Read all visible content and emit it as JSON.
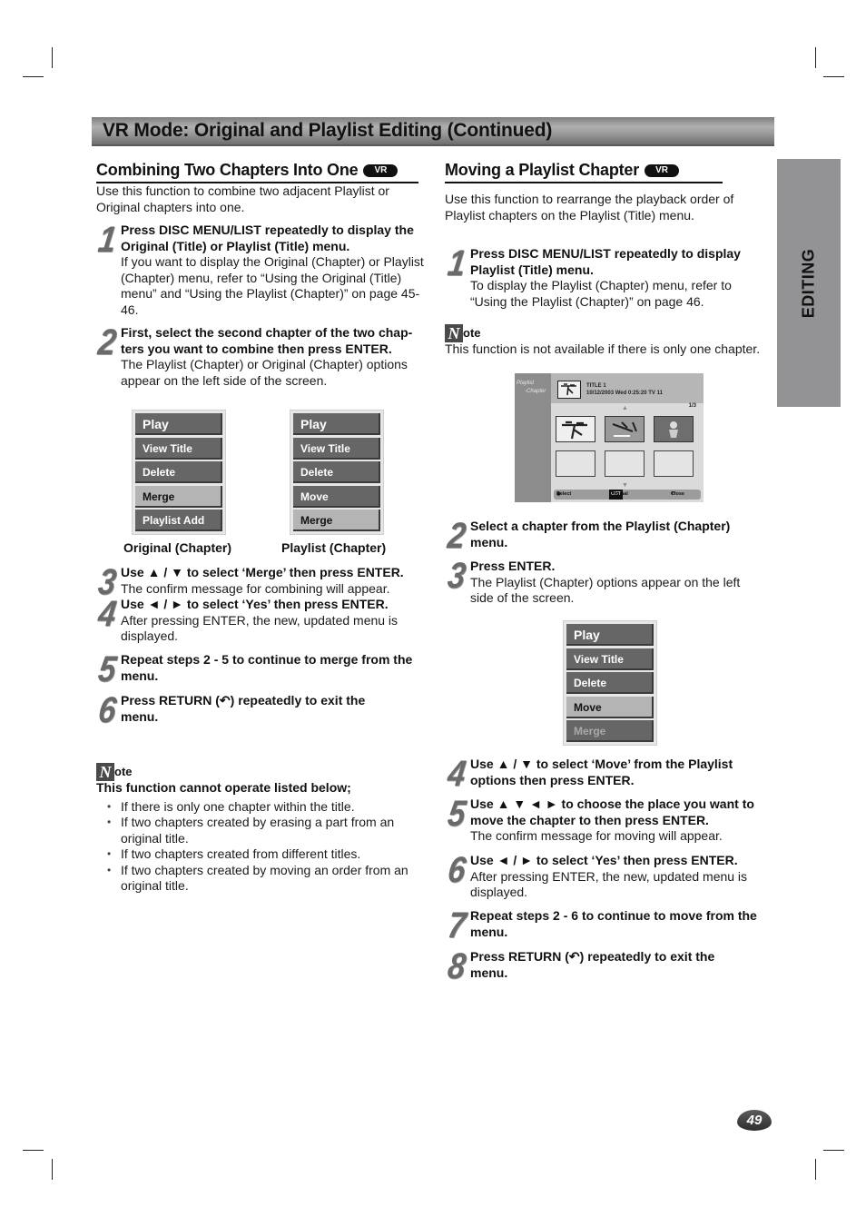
{
  "page": {
    "title": "VR Mode: Original and Playlist Editing (Continued)",
    "side_tab": "EDITING",
    "page_number": "49"
  },
  "left": {
    "heading": "Combining Two Chapters Into One",
    "badge": "VR",
    "intro": "Use this function to combine two adjacent Playlist or Original chapters into one.",
    "steps": [
      {
        "num": "1",
        "head": "Press DISC MENU/LIST repeatedly to display the Original (Title) or Playlist (Title) menu.",
        "desc": "If you want to display the Original (Chapter) or Playlist (Chapter) menu, refer to “Using the Original (Title) menu” and “Using the Playlist (Chapter)” on page 45-46."
      },
      {
        "num": "2",
        "head": "First, select the second chapter of the two chap- ters you want to combine then press ENTER.",
        "desc": "The Playlist (Chapter) or Original (Chapter) options appear on the left side of the screen."
      },
      {
        "num": "3",
        "head": "Use ▲ / ▼ to select ‘Merge’ then press ENTER.",
        "desc": "The confirm message for combining will appear."
      },
      {
        "num": "4",
        "head": "Use ◄ / ► to select ‘Yes’ then press ENTER.",
        "desc": "After pressing ENTER, the new, updated menu is displayed."
      },
      {
        "num": "5",
        "head": "Repeat steps 2 - 5 to continue to merge from the menu.",
        "desc": ""
      },
      {
        "num": "6",
        "head": "Press RETURN (↶) repeatedly to exit the menu.",
        "desc": ""
      }
    ],
    "menus": [
      {
        "caption": "Original (Chapter)",
        "items": [
          "Play",
          "View Title",
          "Delete",
          "Merge",
          "Playlist Add"
        ],
        "selected": 3
      },
      {
        "caption": "Playlist (Chapter)",
        "items": [
          "Play",
          "View Title",
          "Delete",
          "Move",
          "Merge"
        ],
        "selected": 4
      }
    ],
    "note": {
      "icon_letter": "N",
      "label": "ote",
      "lead": "This function cannot operate listed below;",
      "bullets": [
        "If there is only one chapter within the title.",
        "If two chapters created by erasing a part from an original title.",
        "If two chapters created from different titles.",
        "If two chapters created by moving an order from an original title."
      ]
    }
  },
  "right": {
    "heading": "Moving a Playlist Chapter",
    "badge": "VR",
    "intro": "Use this function to rearrange the playback order of Playlist chapters on the Playlist (Title) menu.",
    "steps": [
      {
        "num": "1",
        "head": "Press DISC MENU/LIST repeatedly to display Playlist (Title) menu.",
        "desc": "To display the Playlist (Chapter) menu, refer to “Using the Playlist (Chapter)” on page 46."
      },
      {
        "num": "2",
        "head": "Select a chapter from the Playlist (Chapter) menu.",
        "desc": ""
      },
      {
        "num": "3",
        "head": "Press ENTER.",
        "desc": "The Playlist (Chapter) options appear on the left side of the screen."
      },
      {
        "num": "4",
        "head": "Use ▲ / ▼ to select ‘Move’ from the Playlist options then press ENTER.",
        "desc": ""
      },
      {
        "num": "5",
        "head": "Use ▲ ▼ ◄ ► to choose the place you want to move the chapter to then press ENTER.",
        "desc": "The confirm message for moving will appear."
      },
      {
        "num": "6",
        "head": "Use ◄ / ► to select ‘Yes’ then press ENTER.",
        "desc": "After pressing ENTER, the new, updated menu is displayed."
      },
      {
        "num": "7",
        "head": "Repeat steps 2 - 6 to continue to move from the menu.",
        "desc": ""
      },
      {
        "num": "8",
        "head": "Press RETURN (↶) repeatedly to exit the menu.",
        "desc": ""
      }
    ],
    "note": {
      "icon_letter": "N",
      "label": "ote",
      "text": "This function is not available if there is only one chapter."
    },
    "osd": {
      "side_label_1": "Playlist",
      "side_label_2": "-Chapter",
      "title_line": "TITLE 1",
      "info_line": "10/12/2003  Wed  0:25:20   TV 11",
      "page_indicator": "1/3",
      "footer_select": "Select",
      "footer_list_key": "LIST",
      "footer_original": "Original",
      "footer_close": "Close"
    },
    "menu": {
      "items": [
        "Play",
        "View Title",
        "Delete",
        "Move",
        "Merge"
      ],
      "selected": 3,
      "disabled": 4
    }
  }
}
